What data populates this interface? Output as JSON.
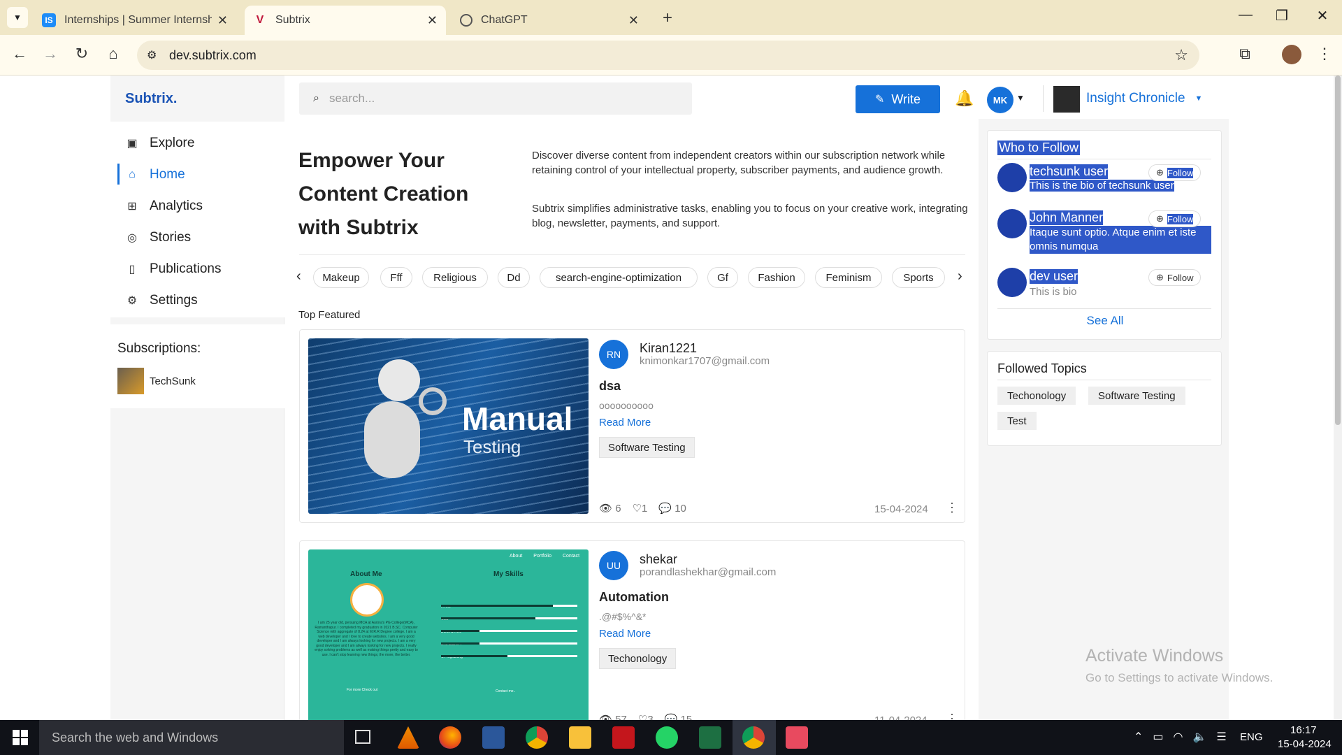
{
  "browser": {
    "tabs": [
      {
        "title": "Internships | Summer Internship",
        "favicon": "IS"
      },
      {
        "title": "Subtrix",
        "favicon": "V",
        "active": true
      },
      {
        "title": "ChatGPT",
        "favicon": "chatgpt-icon"
      }
    ],
    "url": "dev.subtrix.com"
  },
  "header": {
    "logo": "Subtrix.",
    "search_placeholder": "search...",
    "write_label": "Write",
    "user_initials": "MK",
    "publication": "Insight Chronicle"
  },
  "sidebar": {
    "items": [
      {
        "label": "Explore",
        "icon": "explore-icon"
      },
      {
        "label": "Home",
        "icon": "home-icon",
        "active": true
      },
      {
        "label": "Analytics",
        "icon": "analytics-icon"
      },
      {
        "label": "Stories",
        "icon": "stories-icon"
      },
      {
        "label": "Publications",
        "icon": "book-icon"
      },
      {
        "label": "Settings",
        "icon": "gear-icon"
      }
    ],
    "subscriptions_title": "Subscriptions:",
    "subscriptions": [
      {
        "name": "TechSunk"
      }
    ]
  },
  "hero": {
    "title": "Empower Your Content Creation with Subtrix",
    "p1": "Discover diverse content from independent creators within our subscription network while retaining control of your intellectual property, subscriber payments, and audience growth.",
    "p2": "Subtrix simplifies administrative tasks, enabling you to focus on your creative work, integrating blog, newsletter, payments, and support."
  },
  "categories": [
    "Makeup",
    "Fff",
    "Religious",
    "Dd",
    "search-engine-optimization",
    "Gf",
    "Fashion",
    "Feminism",
    "Sports"
  ],
  "featured_title": "Top Featured",
  "posts": [
    {
      "initials": "RN",
      "author": "Kiran1221",
      "email": "knimonkar1707@gmail.com",
      "title": "dsa",
      "excerpt": "oooooooooo",
      "read_more": "Read More",
      "tag": "Software Testing",
      "views": "6",
      "likes": "1",
      "comments": "10",
      "date": "15-04-2024",
      "thumb_title": "Manual",
      "thumb_sub": "Testing"
    },
    {
      "initials": "UU",
      "author": "shekar",
      "email": "porandlashekhar@gmail.com",
      "title": "Automation",
      "excerpt": ".@#$%^&*",
      "read_more": "Read More",
      "tag": "Techonology",
      "views": "57",
      "likes": "3",
      "comments": "15",
      "date": "11-04-2024",
      "thumb_nav": [
        "About",
        "Portfolio",
        "Contact"
      ],
      "thumb_about": "About Me",
      "thumb_skills": "My Skills",
      "thumb_skill_names": [
        "HTML",
        "CSS",
        "BOOTSTRAP",
        "JAVASCRIPT",
        "C Programing"
      ],
      "thumb_bio": "I am 25 year old, persuing MCA at Aurora's PG College(MCA), Ramanthapur. I completed my graduation in 2021 B.SC. Computer Science with aggregate of 8.24 at M.R.R Degree college. I am a web developer and I love to create websites. I am a very good developer and I am always looking for new projects. I am a very good developer and I am always looking for new projects. I really enjoy solving problems as well as making things pretty and easy to use. I can't stop learning new things; the more, the better.",
      "thumb_more": "For more Check out",
      "thumb_contact": "Contact me.."
    }
  ],
  "who_to_follow": {
    "title": "Who to Follow",
    "users": [
      {
        "name": "techsunk user",
        "bio": "This is the bio of techsunk user",
        "follow": "Follow"
      },
      {
        "name": "John Manner",
        "bio": "Itaque sunt optio. Atque enim et iste omnis numqua",
        "follow": "Follow"
      },
      {
        "name": "dev user",
        "bio": "This is bio",
        "follow": "Follow"
      }
    ],
    "see_all": "See All"
  },
  "followed_topics": {
    "title": "Followed Topics",
    "topics": [
      "Techonology",
      "Software Testing",
      "Test"
    ]
  },
  "watermark": {
    "line1": "Activate Windows",
    "line2": "Go to Settings to activate Windows."
  },
  "taskbar": {
    "search": "Search the web and Windows",
    "lang": "ENG",
    "time": "16:17",
    "date": "15-04-2024"
  },
  "colors": {
    "accent": "#1671d9",
    "brand": "#1a53b5",
    "selection": "#2f58c8",
    "tabstrip": "#f0e7c7"
  }
}
